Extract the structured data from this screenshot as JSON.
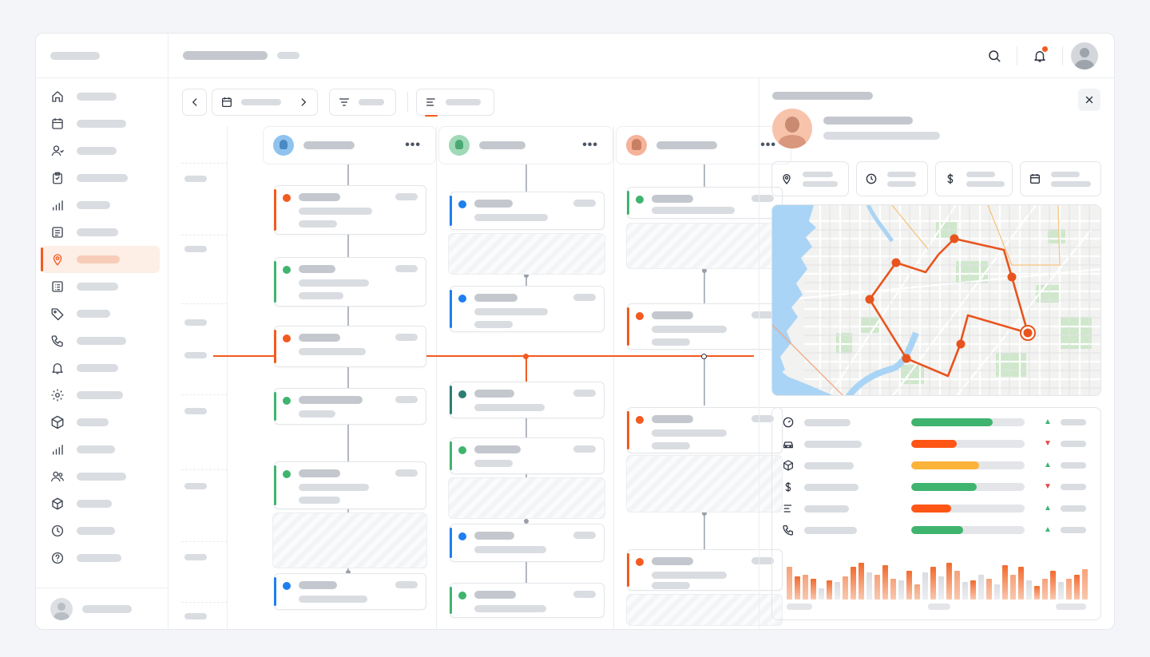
{
  "colors": {
    "accent": "#f25a1f",
    "green": "#3fb46f",
    "blue": "#1e7ff0",
    "teal": "#2e7d73",
    "orange_bar": "#ff5515",
    "yellow_bar": "#fbb33a"
  },
  "icons": {
    "header": [
      "search-icon",
      "bell-icon",
      "user-avatar"
    ],
    "sidebar": [
      "home-icon",
      "calendar-icon",
      "users-icon",
      "clipboard-icon",
      "bar-chart-icon",
      "list-icon",
      "map-pin-icon",
      "list-icon",
      "tag-icon",
      "phone-icon",
      "bell-icon",
      "gear-icon",
      "box-icon",
      "bar-chart-icon",
      "team-icon",
      "cube-icon",
      "clock-icon",
      "help-icon"
    ],
    "toolbar": [
      "chevron-left-icon",
      "calendar-icon",
      "chevron-right-icon",
      "filter-icon",
      "group-icon"
    ],
    "detail_chips": [
      "map-pin-icon",
      "clock-icon",
      "dollar-icon",
      "calendar-icon"
    ],
    "metrics": [
      "gauge-icon",
      "car-icon",
      "cube-icon",
      "dollar-icon",
      "list-icon",
      "phone-icon"
    ]
  },
  "sidebar": {
    "active_index": 6
  },
  "header": {
    "has_notification": true
  },
  "columns": [
    {
      "avatar_color": "#8fc3ef",
      "menu": "•••"
    },
    {
      "avatar_color": "#9fd9b6",
      "menu": "•••"
    },
    {
      "avatar_color": "#f5b39a",
      "menu": "•••"
    }
  ],
  "tasks": [
    {
      "column": 1,
      "status": "orange"
    },
    {
      "column": 1,
      "status": "green"
    },
    {
      "column": 1,
      "status": "orange"
    },
    {
      "column": 1,
      "status": "green"
    },
    {
      "column": 1,
      "status": "green"
    },
    {
      "column": 1,
      "status": "blue"
    },
    {
      "column": 2,
      "status": "blue"
    },
    {
      "column": 2,
      "status": "blue"
    },
    {
      "column": 2,
      "status": "teal"
    },
    {
      "column": 2,
      "status": "green"
    },
    {
      "column": 2,
      "status": "blue"
    },
    {
      "column": 2,
      "status": "green"
    },
    {
      "column": 3,
      "status": "green"
    },
    {
      "column": 3,
      "status": "orange"
    },
    {
      "column": 3,
      "status": "orange"
    },
    {
      "column": 3,
      "status": "orange"
    }
  ],
  "metrics": [
    {
      "icon": "gauge-icon",
      "progress": 0.72,
      "color": "green",
      "trend": "up",
      "trend_glyph": "▲"
    },
    {
      "icon": "car-icon",
      "progress": 0.4,
      "color": "orange",
      "trend": "down",
      "trend_glyph": "▼"
    },
    {
      "icon": "cube-icon",
      "progress": 0.6,
      "color": "yellow",
      "trend": "up",
      "trend_glyph": "▲"
    },
    {
      "icon": "dollar-icon",
      "progress": 0.58,
      "color": "green",
      "trend": "down",
      "trend_glyph": "▼"
    },
    {
      "icon": "list-icon",
      "progress": 0.35,
      "color": "orange",
      "trend": "up",
      "trend_glyph": "▲"
    },
    {
      "icon": "phone-icon",
      "progress": 0.46,
      "color": "green",
      "trend": "up",
      "trend_glyph": "▲"
    }
  ],
  "activity_bars": [
    0.85,
    0.6,
    0.65,
    0.55,
    0.3,
    0.5,
    0.45,
    0.6,
    0.85,
    0.95,
    0.7,
    0.65,
    0.9,
    0.55,
    0.5,
    0.75,
    0.4,
    0.7,
    0.85,
    0.6,
    0.95,
    0.75,
    0.45,
    0.5,
    0.65,
    0.55,
    0.4,
    0.9,
    0.65,
    0.85,
    0.5,
    0.35,
    0.55,
    0.75,
    0.45,
    0.55,
    0.65,
    0.8
  ],
  "activity_bar_styles": [
    "lo",
    "o",
    "lo",
    "o",
    "g",
    "o",
    "g",
    "lo",
    "o",
    "o",
    "g",
    "lo",
    "o",
    "lo",
    "g",
    "o",
    "lo",
    "g",
    "o",
    "g",
    "o",
    "lo",
    "g",
    "o",
    "g",
    "lo",
    "g",
    "o",
    "lo",
    "o",
    "g",
    "o",
    "lo",
    "o",
    "g",
    "lo",
    "o",
    "lo"
  ]
}
